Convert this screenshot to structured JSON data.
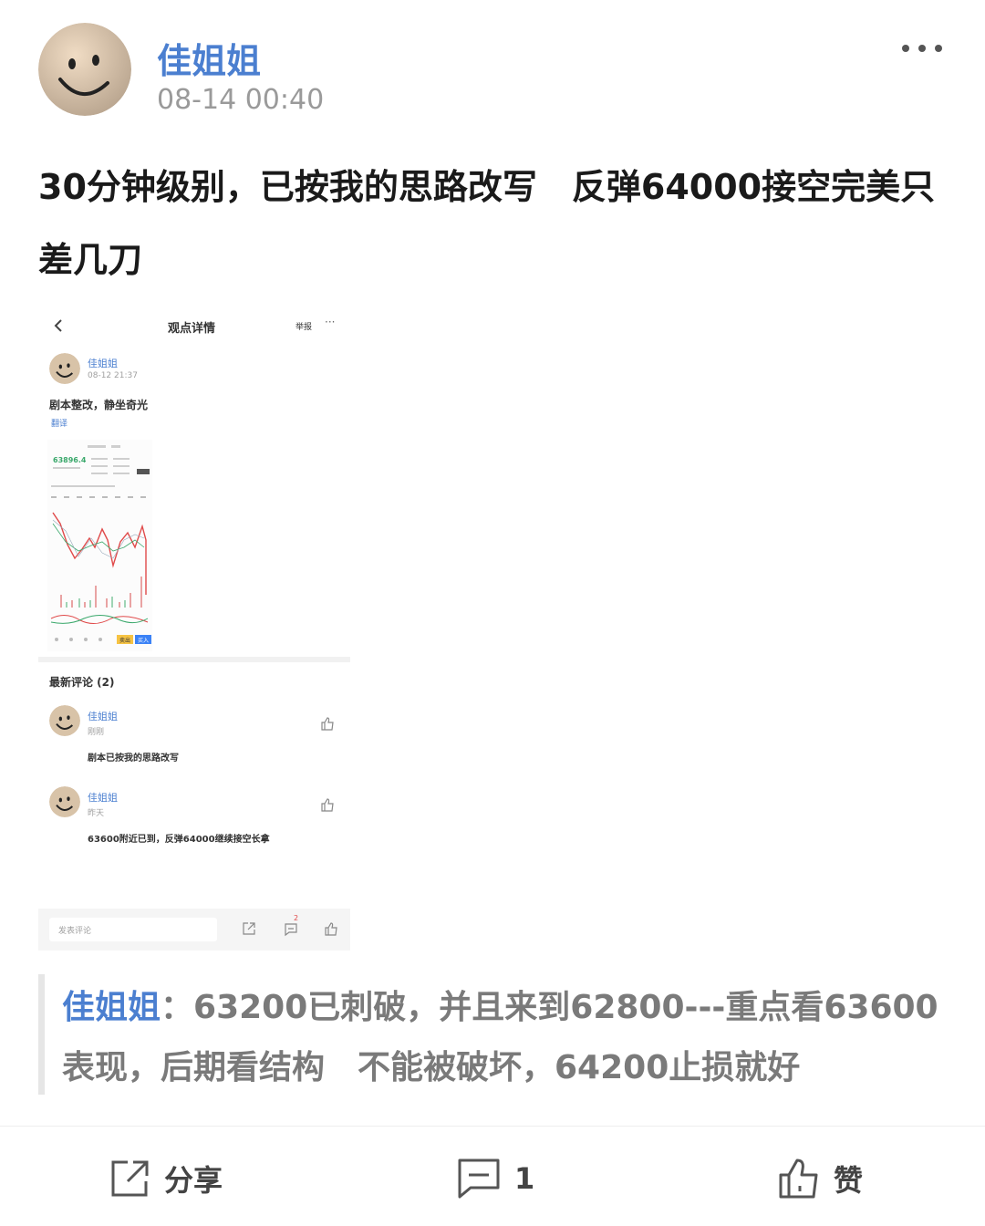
{
  "post": {
    "author": "佳姐姐",
    "time": "08-14 00:40",
    "text": "30分钟级别，已按我的思路改写　反弹64000接空完美只差几刀"
  },
  "embedded_screenshot": {
    "header_title": "观点详情",
    "report_label": "举报",
    "author": "佳姐姐",
    "time": "08-12 21:37",
    "text": "剧本整改，静坐奇光",
    "translate_label": "翻译",
    "chart_price": "63896.4",
    "comments_title": "最新评论 (2)",
    "comments": [
      {
        "author": "佳姐姐",
        "time": "刚刚",
        "text": "剧本已按我的思路改写"
      },
      {
        "author": "佳姐姐",
        "time": "昨天",
        "text": "63600附近已到，反弹64000继续接空长拿"
      }
    ],
    "comment_placeholder": "发表评论",
    "comment_badge": "2",
    "chart_buttons": [
      "卖出",
      "买入"
    ]
  },
  "quote": {
    "name": "佳姐姐",
    "sep": "：",
    "text": "63200已刺破，并且来到62800---重点看63600表现，后期看结构　不能被破坏，64200止损就好"
  },
  "footer": {
    "share_label": "分享",
    "comment_count": "1",
    "like_label": "赞"
  },
  "colors": {
    "accent": "#4b7fd0",
    "chart_red": "#e04a4a",
    "chart_green": "#3aa86b"
  }
}
